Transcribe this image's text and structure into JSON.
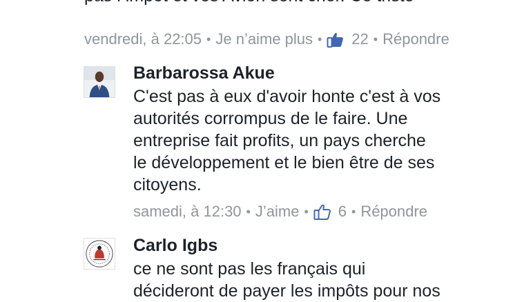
{
  "comments": [
    {
      "text_lines": [
        "pas l impot et vos Avion sont cher. Ce triste"
      ],
      "meta": {
        "time": "vendredi, à 22:05",
        "action": "Je n’aime plus",
        "likes": "22",
        "reply": "Répondre"
      },
      "icon": "thumbs-up-icon",
      "like_color": "#4267b2"
    },
    {
      "author": "Barbarossa Akue",
      "avatar": "profile-photo",
      "text_lines": [
        "C'est pas à eux d'avoir honte c'est à  vos",
        "autorités  corrompus  de le faire. Une",
        "entreprise  fait profits, un pays cherche",
        "le développement  et le bien être de ses",
        "citoyens."
      ],
      "meta": {
        "time": "samedi, à 12:30",
        "action": "J’aime",
        "likes": "6",
        "reply": "Répondre"
      },
      "icon": "thumbs-up-icon"
    },
    {
      "author": "Carlo Igbs",
      "avatar": "seal-logo",
      "text_lines": [
        "ce ne sont pas les français qui",
        "décideront de payer les impôts pour nos"
      ]
    }
  ],
  "colors": {
    "text": "#1d2129",
    "meta": "#90949c",
    "like_blue": "#4267b2"
  }
}
